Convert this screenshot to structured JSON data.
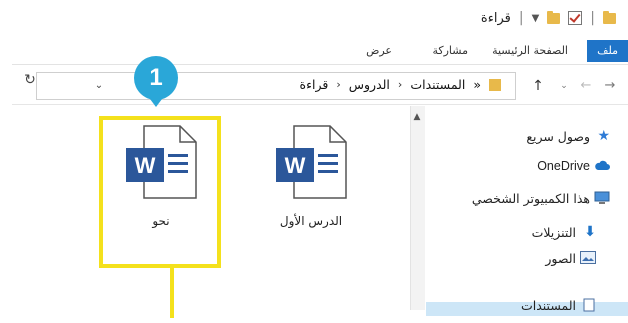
{
  "window": {
    "title": "قراءة"
  },
  "ribbon": {
    "tabs": [
      {
        "label": "ملف"
      },
      {
        "label": "الصفحة الرئيسية"
      },
      {
        "label": "مشاركة"
      },
      {
        "label": "عرض"
      }
    ]
  },
  "address": {
    "crumbs": [
      "المستندات",
      "الدروس",
      "قراءة"
    ],
    "overflow": "«"
  },
  "nav_pane": {
    "items": [
      {
        "label": "وصول سريع",
        "icon": "star-icon"
      },
      {
        "label": "OneDrive",
        "icon": "cloud-icon"
      },
      {
        "label": "هذا الكمبيوتر الشخصي",
        "icon": "computer-icon"
      },
      {
        "label": "التنزيلات",
        "icon": "download-icon"
      },
      {
        "label": "الصور",
        "icon": "pictures-icon"
      },
      {
        "label": "المستندات",
        "icon": "documents-icon"
      }
    ]
  },
  "files": [
    {
      "name": "نحو",
      "icon": "word-document-icon"
    },
    {
      "name": "الدرس الأول",
      "icon": "word-document-icon"
    }
  ],
  "annotation": {
    "step": "1"
  },
  "colors": {
    "accent": "#1f74c8",
    "highlight": "#f4e11c",
    "badge": "#2aa7d8",
    "word_blue": "#2b579a"
  }
}
